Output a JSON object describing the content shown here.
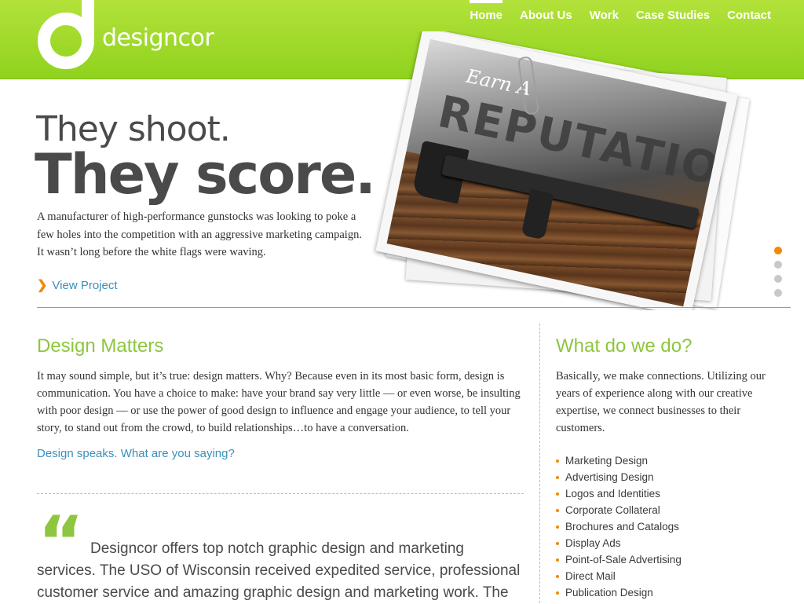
{
  "brand": {
    "name": "designcor",
    "accent": "#8dc63f",
    "link": "#3a8fba",
    "bullet": "#f08a00"
  },
  "nav": [
    {
      "label": "Home",
      "active": true
    },
    {
      "label": "About Us"
    },
    {
      "label": "Work"
    },
    {
      "label": "Case Studies"
    },
    {
      "label": "Contact"
    }
  ],
  "hero": {
    "line1": "They shoot.",
    "line2": "They score.",
    "description": "A manufacturer of high-performance gunstocks was looking to poke a few holes into the competition with an aggressive marketing campaign. It wasn’t long before the white flags were waving.",
    "cta": "View Project",
    "image": {
      "script": "Earn A",
      "headline": "REPUTATION"
    },
    "slides": {
      "count": 4,
      "active_index": 0
    }
  },
  "design_matters": {
    "title": "Design Matters",
    "body": "It may sound simple, but it’s true: design matters. Why? Because even in its most basic form, design is communication. You have a choice to make: have your brand say very little — or even worse, be insulting with poor design — or use the power of good design to influence and engage your audience, to tell your story, to stand out from the crowd, to build relationships…to have a conversation.",
    "link": "Design speaks. What are you saying?"
  },
  "testimonial": {
    "quote_mark": "“",
    "text": "Designcor offers top notch graphic design and marketing services. The USO of Wisconsin received expedited service, professional customer service and amazing graphic design and marketing work. The"
  },
  "what_we_do": {
    "title": "What do we do?",
    "body": "Basically, we make connections. Utilizing our years of experience along with our creative expertise, we connect businesses to their customers.",
    "services": [
      "Marketing Design",
      "Advertising Design",
      "Logos and Identities",
      "Corporate Collateral",
      "Brochures and Catalogs",
      "Display Ads",
      "Point-of-Sale Advertising",
      "Direct Mail",
      "Publication Design"
    ]
  }
}
